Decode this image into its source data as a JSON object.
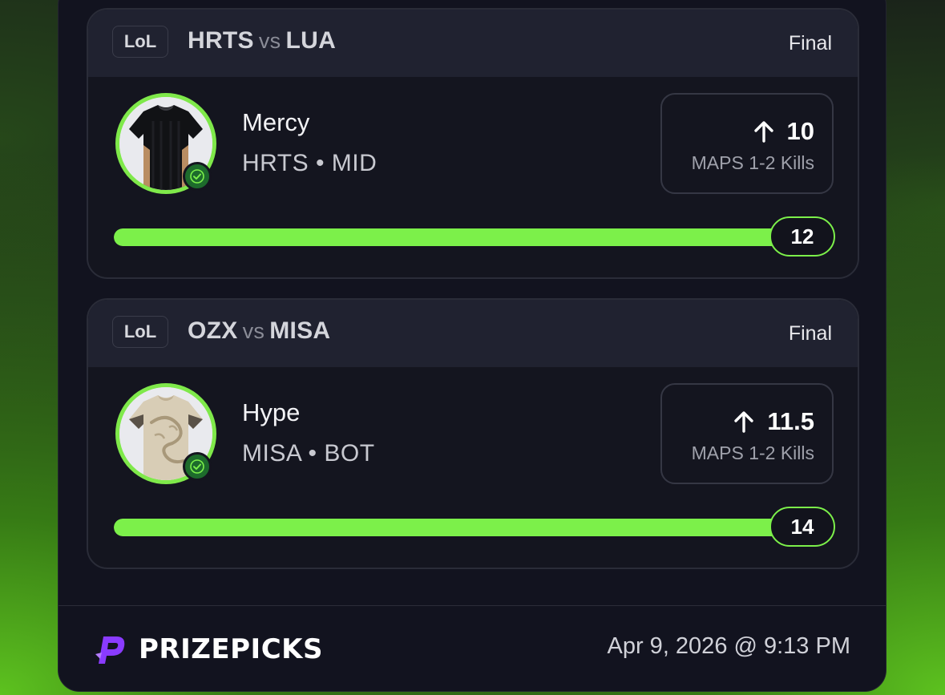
{
  "picks": [
    {
      "league": "LoL",
      "team_a": "HRTS",
      "vs": "vs",
      "team_b": "LUA",
      "status": "Final",
      "player": "Mercy",
      "meta": "HRTS • MID",
      "direction": "up-arrow-icon",
      "line": "10",
      "stat": "MAPS 1-2 Kills",
      "result": "12",
      "progress_fraction": 1.0,
      "jersey": "black-jersey-icon"
    },
    {
      "league": "LoL",
      "team_a": "OZX",
      "vs": "vs",
      "team_b": "MISA",
      "status": "Final",
      "player": "Hype",
      "meta": "MISA • BOT",
      "direction": "up-arrow-icon",
      "line": "11.5",
      "stat": "MAPS 1-2 Kills",
      "result": "14",
      "progress_fraction": 1.0,
      "jersey": "cream-dragon-jersey-icon"
    }
  ],
  "footer": {
    "brand": "PRIZEPICKS",
    "timestamp": "Apr 9, 2026 @ 9:13 PM"
  },
  "colors": {
    "accent_green": "#7cf04a",
    "panel": "#12131f",
    "header": "#202230",
    "brand_purple": "#8a3bff"
  }
}
